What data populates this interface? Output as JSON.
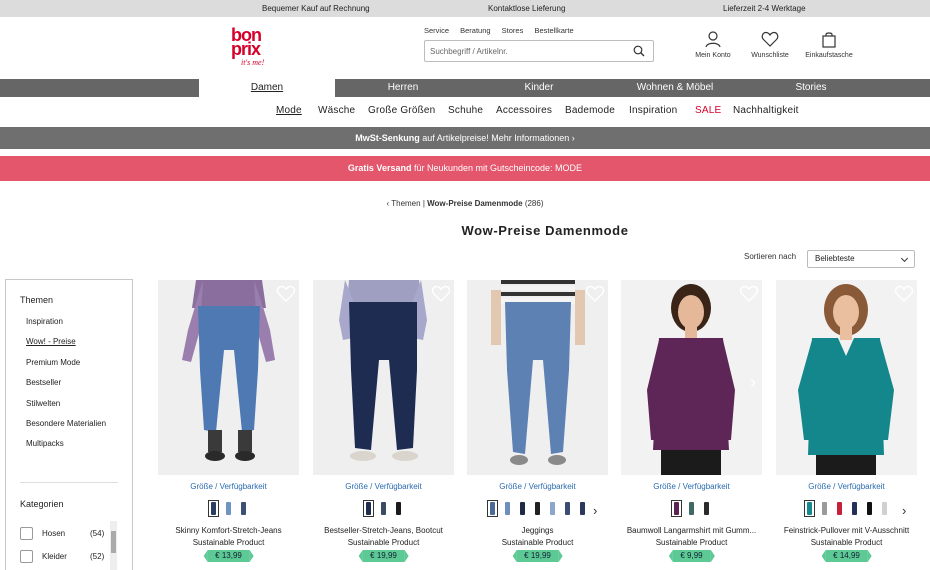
{
  "topbar": {
    "left": "Bequemer Kauf auf Rechnung",
    "center": "Kontaktlose Lieferung",
    "right": "Lieferzeit 2-4 Werktage"
  },
  "logo": {
    "line1": "bon",
    "line2": "prix",
    "tagline": "it's me!"
  },
  "service_links": [
    "Service",
    "Beratung",
    "Stores",
    "Bestellkarte"
  ],
  "search": {
    "placeholder": "Suchbegriff / Artikelnr."
  },
  "header_icons": {
    "account": "Mein Konto",
    "wishlist": "Wunschliste",
    "bag": "Einkaufstasche"
  },
  "category_nav": [
    "Damen",
    "Herren",
    "Kinder",
    "Wohnen & Möbel",
    "Stories"
  ],
  "subnav": [
    "Mode",
    "Wäsche",
    "Große Größen",
    "Schuhe",
    "Accessoires",
    "Bademode",
    "Inspiration",
    "SALE",
    "Nachhaltigkeit"
  ],
  "banner1": {
    "bold": "MwSt-Senkung",
    "text": "auf Artikelpreise! Mehr Informationen ›"
  },
  "banner2": {
    "bold": "Gratis Versand",
    "text": "für Neukunden mit Gutscheincode: MODE"
  },
  "breadcrumb": {
    "back": "Themen",
    "current": "Wow-Preise Damenmode",
    "count": "(286)"
  },
  "page_title": "Wow-Preise Damenmode",
  "sort": {
    "label": "Sortieren nach",
    "value": "Beliebteste"
  },
  "sidebar": {
    "themen_title": "Themen",
    "themen": [
      "Inspiration",
      "Wow! - Preise",
      "Premium Mode",
      "Bestseller",
      "Stilwelten",
      "Besondere Materialien",
      "Multipacks"
    ],
    "kategorien_title": "Kategorien",
    "kategorien": [
      {
        "label": "Hosen",
        "count": "(54)"
      },
      {
        "label": "Kleider",
        "count": "(52)"
      }
    ]
  },
  "size_label": "Größe / Verfügbarkeit",
  "products": [
    {
      "name": "Skinny Komfort-Stretch-Jeans",
      "tag": "Sustainable Product",
      "price": "€ 13,99",
      "swatches": [
        "#2b3d63",
        "#6f94c4",
        "#3d4f73"
      ]
    },
    {
      "name": "Bestseller-Stretch-Jeans, Bootcut",
      "tag": "Sustainable Product",
      "price": "€ 19,99",
      "swatches": [
        "#1f2c4d",
        "#3b4a66",
        "#1b1b1b"
      ]
    },
    {
      "name": "Jeggings",
      "tag": "Sustainable Product",
      "price": "€ 19,99",
      "swatches": [
        "#4c6a96",
        "#6c8fbd",
        "#1f2b45",
        "#222222",
        "#8aa6cb",
        "#3b4d73",
        "#2b3a5c"
      ]
    },
    {
      "name": "Baumwoll Langarmshirt mit Gumm...",
      "tag": "Sustainable Product",
      "price": "€ 9,99",
      "swatches": [
        "#5b2450",
        "#3f6b66",
        "#2b2b2b"
      ]
    },
    {
      "name": "Feinstrick-Pullover mit V-Ausschnitt",
      "tag": "Sustainable Product",
      "price": "€ 14,99",
      "swatches": [
        "#17898f",
        "#9a9a9a",
        "#c8203b",
        "#25305a",
        "#111111",
        "#d0d0d0"
      ]
    }
  ],
  "colors": {
    "brand": "#d6002a",
    "promo": "#e4566c",
    "price_tag": "#5dc995",
    "link": "#2a6bb0"
  }
}
